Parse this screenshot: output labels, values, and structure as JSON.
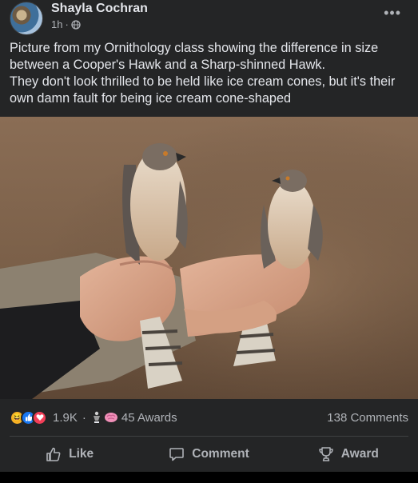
{
  "post": {
    "author": "Shayla Cochran",
    "time": "1h",
    "separator": "·",
    "text_lines": [
      "Picture from my Ornithology class showing the difference in size between a Cooper's Hawk and a Sharp-shinned Hawk.",
      "They don't look thrilled to be held like ice cream cones, but it's their own damn fault for being ice cream cone-shaped"
    ]
  },
  "stats": {
    "reaction_count": "1.9K",
    "dot": "·",
    "awards": "45 Awards",
    "comments": "138 Comments"
  },
  "actions": {
    "like": "Like",
    "comment": "Comment",
    "award": "Award"
  },
  "colors": {
    "background": "#242526",
    "text": "#e4e6eb",
    "secondary": "#b0b3b8",
    "like_blue": "#1877f2",
    "love_red": "#f33e58",
    "haha_yellow": "#f7b125"
  },
  "icons": {
    "privacy": "globe-icon",
    "more": "more-options-icon",
    "like": "thumbs-up-icon",
    "comment": "speech-bubble-icon",
    "award": "trophy-icon"
  }
}
